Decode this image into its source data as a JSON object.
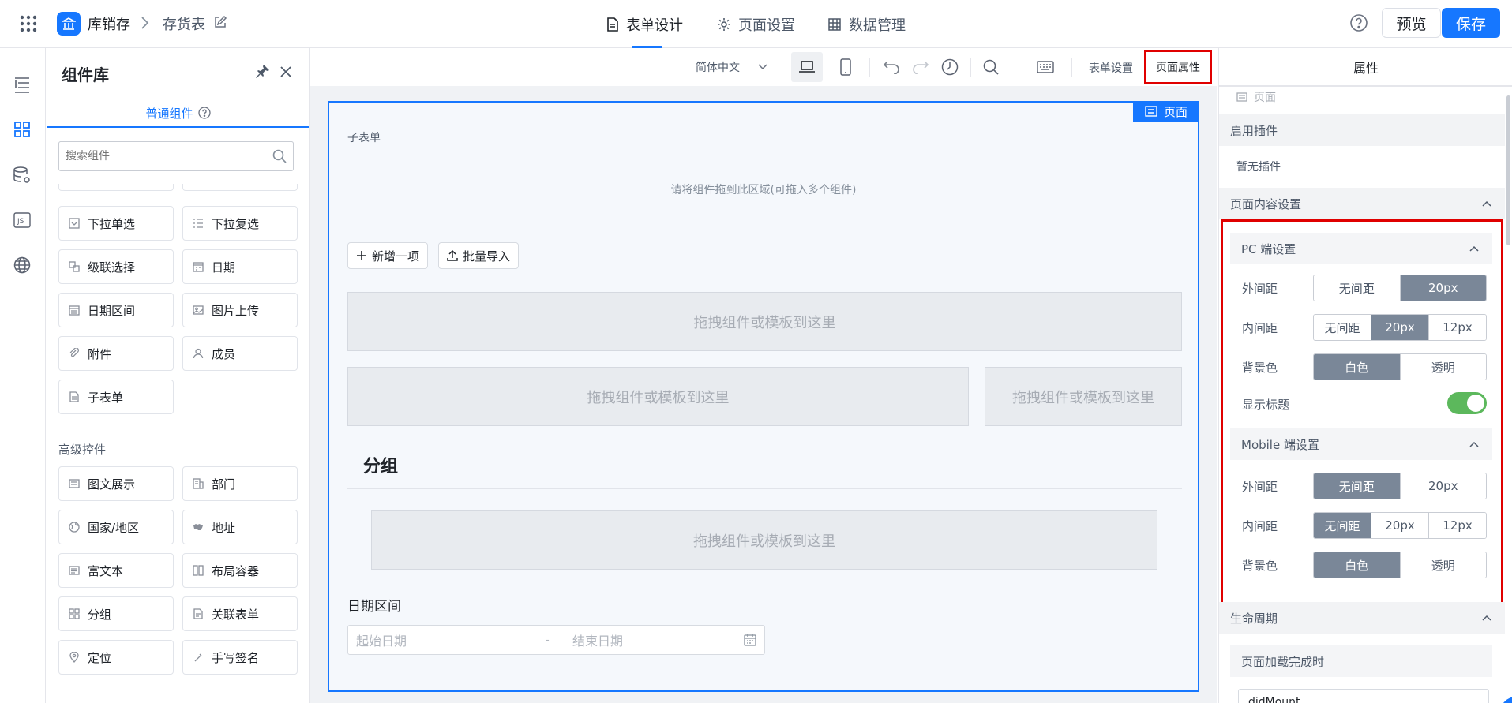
{
  "header": {
    "app_name": "库销存",
    "breadcrumb_current": "存货表",
    "tabs": [
      {
        "label": "表单设计",
        "icon": "document-icon",
        "active": true
      },
      {
        "label": "页面设置",
        "icon": "gear-icon",
        "active": false
      },
      {
        "label": "数据管理",
        "icon": "grid-icon",
        "active": false
      }
    ],
    "preview_label": "预览",
    "save_label": "保存",
    "accent_color": "#1677ff"
  },
  "library": {
    "title": "组件库",
    "tab_label": "普通组件",
    "search_placeholder": "搜索组件",
    "basic_items": [
      {
        "label": "下拉单选",
        "icon": "dropdown-single-icon"
      },
      {
        "label": "下拉复选",
        "icon": "dropdown-multi-icon"
      },
      {
        "label": "级联选择",
        "icon": "cascade-icon"
      },
      {
        "label": "日期",
        "icon": "calendar-icon"
      },
      {
        "label": "日期区间",
        "icon": "date-range-icon"
      },
      {
        "label": "图片上传",
        "icon": "image-icon"
      },
      {
        "label": "附件",
        "icon": "paperclip-icon"
      },
      {
        "label": "成员",
        "icon": "user-icon"
      },
      {
        "label": "子表单",
        "icon": "subform-icon"
      }
    ],
    "advanced_title": "高级控件",
    "advanced_items": [
      {
        "label": "图文展示",
        "icon": "image-text-icon"
      },
      {
        "label": "部门",
        "icon": "department-icon"
      },
      {
        "label": "国家/地区",
        "icon": "globe-icon"
      },
      {
        "label": "地址",
        "icon": "map-icon"
      },
      {
        "label": "富文本",
        "icon": "richtext-icon"
      },
      {
        "label": "布局容器",
        "icon": "layout-icon"
      },
      {
        "label": "分组",
        "icon": "group-icon"
      },
      {
        "label": "关联表单",
        "icon": "link-form-icon"
      },
      {
        "label": "定位",
        "icon": "location-icon"
      },
      {
        "label": "手写签名",
        "icon": "signature-icon"
      }
    ]
  },
  "toolbar": {
    "language": "简体中文",
    "form_settings": "表单设置",
    "page_props": "页面属性"
  },
  "canvas": {
    "page_badge": "页面",
    "subform_label": "子表单",
    "subform_hint": "请将组件拖到此区域(可拖入多个组件)",
    "add_item": "新增一项",
    "bulk_import": "批量导入",
    "drop_hint": "拖拽组件或模板到这里",
    "group_title": "分组",
    "date_range_label": "日期区间",
    "start_placeholder": "起始日期",
    "range_sep": "-",
    "end_placeholder": "结束日期"
  },
  "props": {
    "tab_label": "属性",
    "node_label": "页面",
    "plugins_head": "启用插件",
    "plugins_empty": "暂无插件",
    "content_head": "页面内容设置",
    "pc_head": "PC 端设置",
    "mobile_head": "Mobile 端设置",
    "margin_label": "外间距",
    "padding_label": "内间距",
    "bg_label": "背景色",
    "show_title_label": "显示标题",
    "show_title_on": true,
    "opt_none": "无间距",
    "opt_20": "20px",
    "opt_12": "12px",
    "opt_white": "白色",
    "opt_transparent": "透明",
    "lifecycle_head": "生命周期",
    "onload_head": "页面加载完成时",
    "handler_text": "didMount"
  }
}
